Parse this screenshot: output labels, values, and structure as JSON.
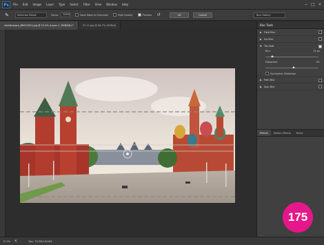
{
  "app": {
    "logo": "Ps",
    "menu": [
      "File",
      "Edit",
      "Image",
      "Layer",
      "Type",
      "Select",
      "Filter",
      "View",
      "Window",
      "Help"
    ],
    "window_controls": [
      "−",
      "□",
      "×"
    ]
  },
  "options": {
    "tool_icon": "brush-icon",
    "selection_select": "Selection Bleed:",
    "focus_label": "Focus:",
    "focus_value": "100%",
    "save_mask_label": "Save Mask to Channels",
    "high_quality_label": "High Quality",
    "preview_label": "Preview",
    "ok_label": "OK",
    "cancel_label": "Cancel",
    "workspace": "Blur Gallery"
  },
  "tabs": [
    {
      "label": "shutterstock_88415031.jpg @ 12.5% (Layer 1, RGB/8#) *",
      "active": true
    },
    {
      "label": "07-12.jpg @ 66.7% (RGB/8)",
      "active": false
    }
  ],
  "blur_tools": {
    "title": "Blur Tools",
    "items": [
      {
        "label": "Field Blur",
        "checked": false,
        "expanded": false
      },
      {
        "label": "Iris Blur",
        "checked": false,
        "expanded": false
      },
      {
        "label": "Tilt-Shift",
        "checked": true,
        "expanded": true
      },
      {
        "label": "Path Blur",
        "checked": false,
        "expanded": false
      },
      {
        "label": "Spin Blur",
        "checked": false,
        "expanded": false
      }
    ],
    "blur_label": "Blur:",
    "blur_value": "15 px",
    "blur_level": 0.1,
    "distortion_label": "Distortion:",
    "distortion_value": "0%",
    "distortion_level": 0.5,
    "symmetric_label": "Symmetric Distortion"
  },
  "lower_panel": {
    "tabs": [
      "Effects",
      "Motion Effects",
      "Noise"
    ]
  },
  "status": {
    "zoom": "12.5%",
    "doc": "Doc: 70.3M/140.6M"
  },
  "badge": "175",
  "colors": {
    "badge": "#e6178a",
    "panel": "#404040",
    "canvas": "#2d2d2d"
  }
}
